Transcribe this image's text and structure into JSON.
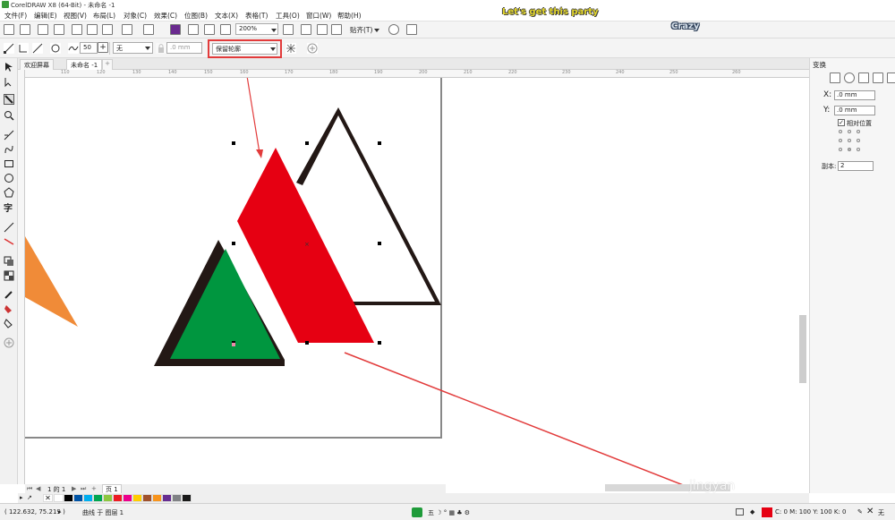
{
  "window": {
    "title": "CorelDRAW X8 (64-Bit) - 未命名 -1"
  },
  "menu": [
    "文件(F)",
    "编辑(E)",
    "视图(V)",
    "布局(L)",
    "对象(C)",
    "效果(C)",
    "位图(B)",
    "文本(X)",
    "表格(T)",
    "工具(O)",
    "窗口(W)",
    "帮助(H)"
  ],
  "overlay": {
    "party": "Let's get this party",
    "crazy": "Crazy"
  },
  "standard_toolbar": {
    "zoom": "200%",
    "snap_label": "贴齐(T)"
  },
  "property_bar": {
    "size_value": "50",
    "line_style": "无",
    "width_value": ".0 mm",
    "keep_outline": "保留轮廓"
  },
  "tabs": {
    "welcome": "欢迎屏幕",
    "doc": "未命名 -1"
  },
  "ruler_ticks": [
    "110",
    "120",
    "130",
    "140",
    "150",
    "160",
    "170",
    "180",
    "190",
    "200",
    "210",
    "220",
    "230",
    "240",
    "250",
    "260"
  ],
  "docker": {
    "title": "变换",
    "x_label": "X:",
    "x_value": ".0 mm",
    "y_label": "Y:",
    "y_value": ".0 mm",
    "relative_label": "相对位置",
    "copies_label": "副本:",
    "copies_value": "2"
  },
  "pagenav": {
    "counter": "1 的 1",
    "page_tab": "页 1"
  },
  "palette_colors": [
    "#ffffff",
    "#000000",
    "#0054a6",
    "#00aeef",
    "#00a651",
    "#8dc63f",
    "#ed1c24",
    "#ec008c",
    "#ffcc00",
    "#a0522d",
    "#f7941d",
    "#662d91",
    "#808285",
    "#1a1a1a"
  ],
  "status": {
    "coords": "( 122.632, 75.219 )",
    "layer": "曲线 于 图层 1",
    "fill_color_readout": "C: 0 M: 100 Y: 100 K: 0",
    "outline_label": "无"
  },
  "shapes": {
    "green_fill": "#00963f",
    "red_fill": "#e60012",
    "outline": "#231815",
    "orange_fill": "#f08b38"
  },
  "watermark": "jingyan"
}
